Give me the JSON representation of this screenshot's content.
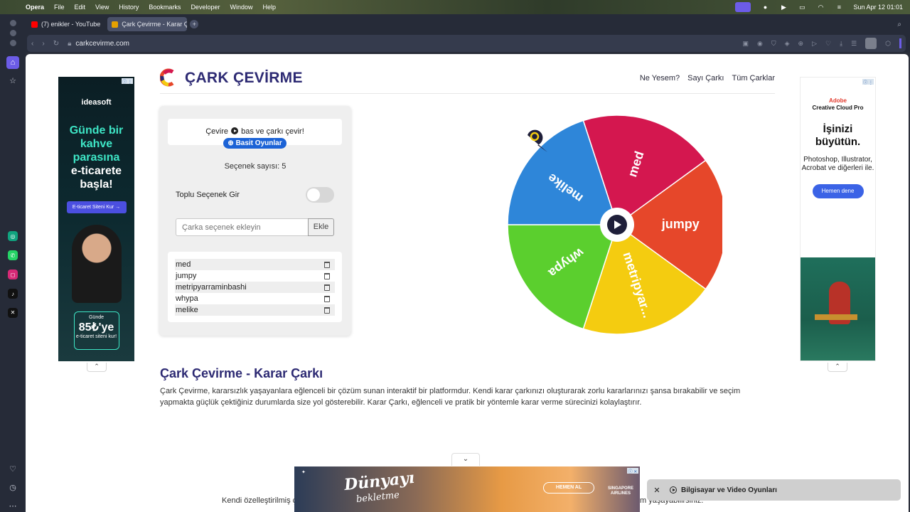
{
  "menubar": {
    "items": [
      "Opera",
      "File",
      "Edit",
      "View",
      "History",
      "Bookmarks",
      "Developer",
      "Window",
      "Help"
    ],
    "datetime": "Sun Apr 12  01:01"
  },
  "tabs": [
    {
      "title": "(7) enikler - YouTube",
      "color": "#ff0000"
    },
    {
      "title": "Çark Çevirme - Karar Ça",
      "color": "#e5a100"
    }
  ],
  "address": {
    "url": "carkcevirme.com"
  },
  "site": {
    "title": "ÇARK ÇEVİRME",
    "nav": [
      "Ne Yesem?",
      "Sayı Çarkı",
      "Tüm Çarklar"
    ]
  },
  "panel": {
    "prompt_before": "Çevire ",
    "prompt_after": " bas ve çarkı çevir!",
    "games_button": "⊕ Basit Oyunlar",
    "count_label": "Seçenek sayısı: 5",
    "bulk_label": "Toplu Seçenek Gir",
    "input_placeholder": "Çarka seçenek ekleyin",
    "add_button": "Ekle",
    "options": [
      "med",
      "jumpy",
      "metripyarraminbashi",
      "whypa",
      "melike"
    ]
  },
  "wheel": {
    "segments": [
      {
        "label": "med",
        "color": "#d4174f"
      },
      {
        "label": "jumpy",
        "color": "#e6472a"
      },
      {
        "label": "metripyar...",
        "color": "#f4cc10"
      },
      {
        "label": "whypa",
        "color": "#5bcf2e"
      },
      {
        "label": "melike",
        "color": "#2e86d9"
      }
    ]
  },
  "article": {
    "title": "Çark Çevirme - Karar Çarkı",
    "body": "Çark Çevirme, kararsızlık yaşayanlara eğlenceli bir çözüm sunan interaktif bir platformdur. Kendi karar çarkınızı oluşturarak zorlu kararlarınızı şansa bırakabilir ve seçim yapmakta güçlük çektiğiniz durumlarda size yol gösterebilir. Karar Çarkı, eğlenceli ve pratik bir yöntemle karar verme sürecinizi kolaylaştırır.",
    "partial_left": "Kendi özelleştirilmiş ç",
    "partial_right": "m yaşayabilirsiniz."
  },
  "ad_left": {
    "brand": "ideasoft",
    "headline_1": "Günde bir kahve parasına",
    "headline_2": "e-ticarete başla!",
    "cta": "E-ticaret Siteni Kur →",
    "price_top": "Günde",
    "price": "85₺'ye",
    "price_bottom": "e-ticaret siteni kur!"
  },
  "ad_right": {
    "brand_1": "Adobe",
    "brand_2": "Creative Cloud Pro",
    "headline": "İşinizi büyütün.",
    "apps": "Photoshop, Illustrator, Acrobat ve diğerleri ile.",
    "cta": "Hemen dene"
  },
  "ad_bottom": {
    "headline": "Dünyayı",
    "subline": "bekletme",
    "cta": "HEMEN AL",
    "airline": "SINGAPORE AIRLINES"
  },
  "toast": {
    "text": "Bilgisayar ve Video Oyunları"
  },
  "colors": {
    "brand": "#2d2a73",
    "accent": "#1c63d6",
    "opera": "#6c5ce7"
  }
}
